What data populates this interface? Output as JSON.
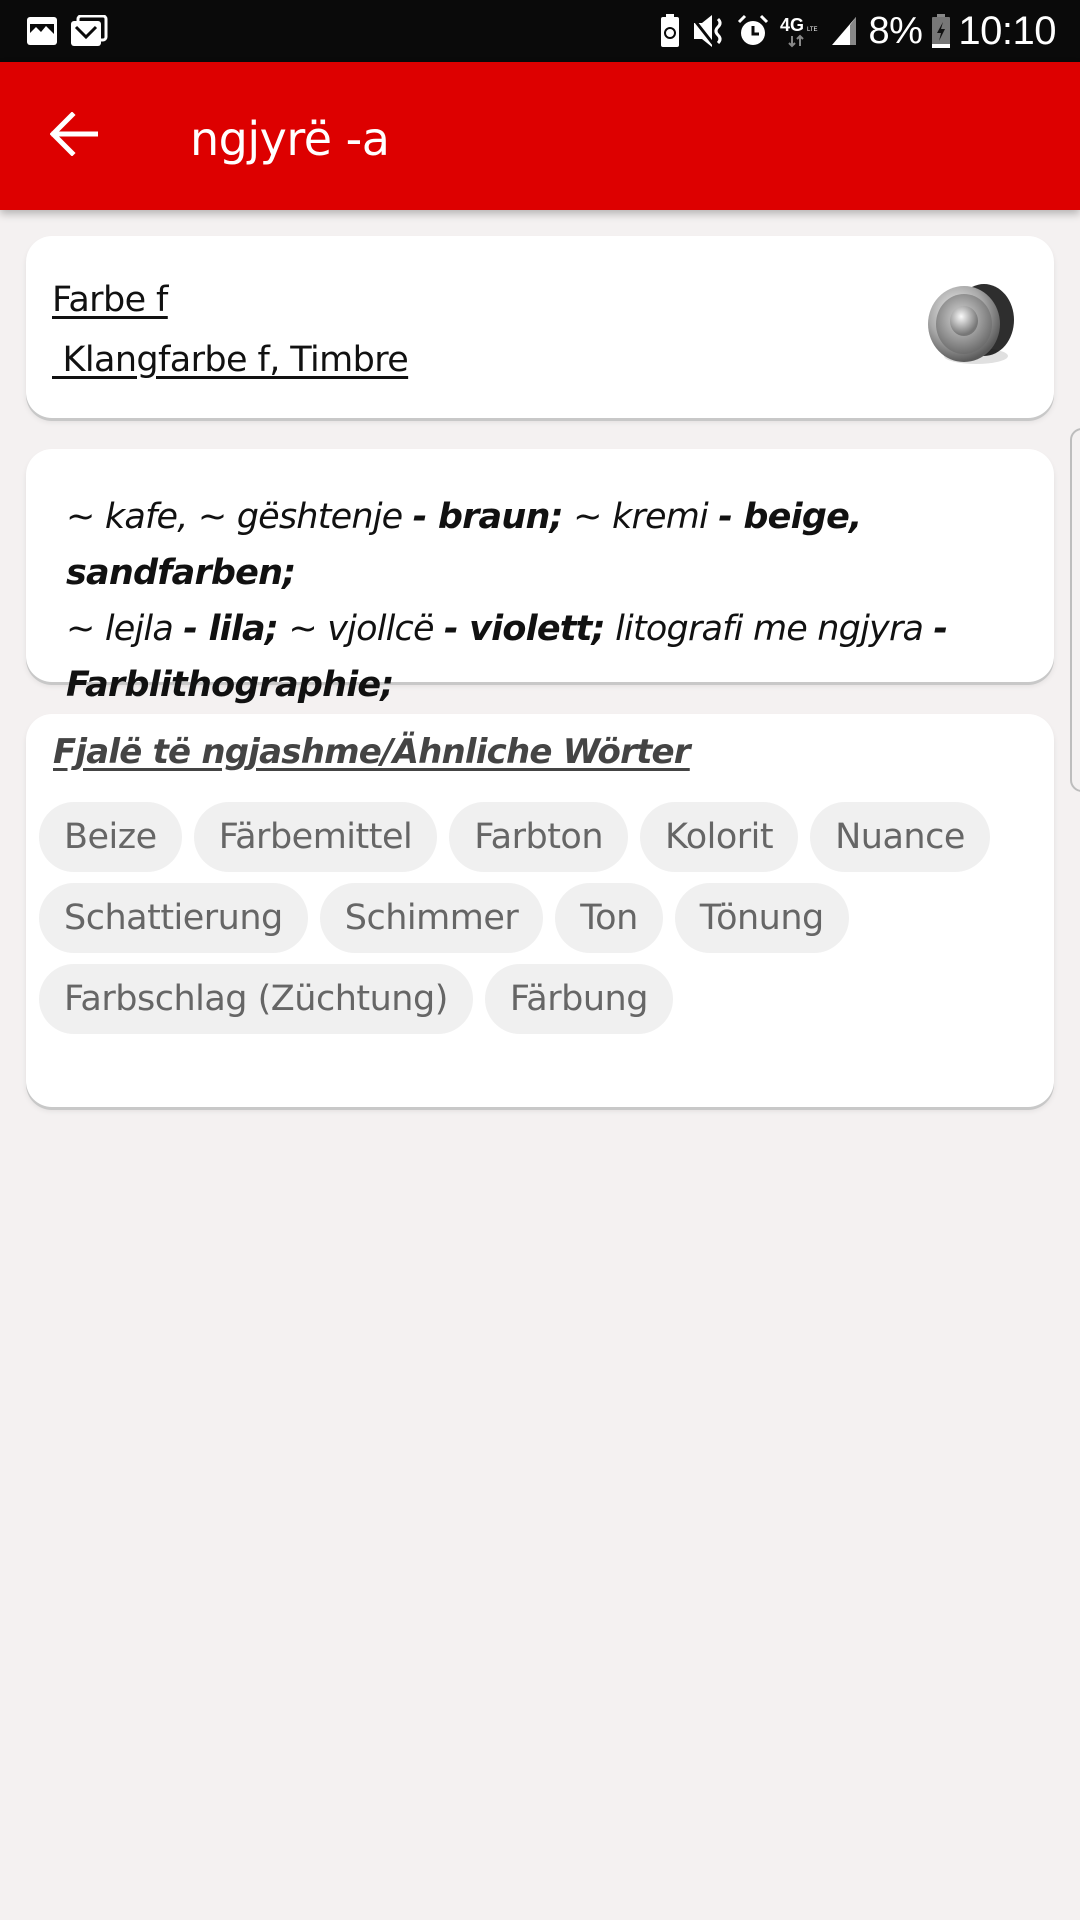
{
  "status_bar": {
    "left_icons": [
      "gallery-icon",
      "email-icon"
    ],
    "right_icons": [
      "battery-saver-icon",
      "vibrate-mute-icon",
      "alarm-icon",
      "lte-4g-icon",
      "signal-icon"
    ],
    "network_label": "4G",
    "battery_percent": "8%",
    "time": "10:10"
  },
  "app_bar": {
    "back_icon": "arrow-left-icon",
    "title": "ngjyrë -a",
    "background_color": "#dd0000"
  },
  "translation": {
    "line1": "Farbe f",
    "line2": " Klangfarbe f, Timbre",
    "speaker_icon": "speaker-icon"
  },
  "examples": {
    "segments": [
      {
        "text": "~ kafe, ~ gështenje ",
        "bold": false
      },
      {
        "text": "- braun;",
        "bold": true
      },
      {
        "text": " ~ kremi ",
        "bold": false
      },
      {
        "text": "- beige, sandfarben;",
        "bold": true
      },
      {
        "text": " ~ lejla ",
        "bold": false
      },
      {
        "text": "- lila;",
        "bold": true
      },
      {
        "text": " ~ vjollcë ",
        "bold": false
      },
      {
        "text": "- violett;",
        "bold": true
      },
      {
        "text": " litografi me ngjyra ",
        "bold": false
      },
      {
        "text": "- Farblithographie;",
        "bold": true
      }
    ]
  },
  "similar_words": {
    "heading": "Fjalë të ngjashme/Ähnliche Wörter",
    "chips": [
      "Beize",
      "Färbemittel",
      "Farbton",
      "Kolorit",
      "Nuance",
      "Schattierung",
      "Schimmer",
      "Ton",
      "Tönung",
      "Farbschlag (Züchtung)",
      "Färbung"
    ]
  }
}
